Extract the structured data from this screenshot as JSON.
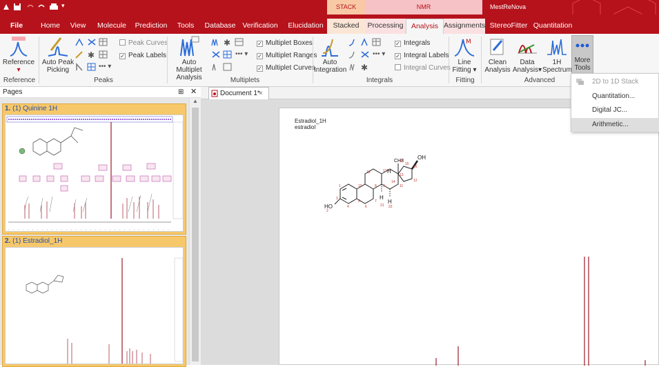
{
  "titlebar": {
    "group_stack": "STACK",
    "group_nmr": "NMR",
    "group_mestrenova": "MestReNova"
  },
  "tabs": [
    {
      "label": "File"
    },
    {
      "label": "Home"
    },
    {
      "label": "View"
    },
    {
      "label": "Molecule"
    },
    {
      "label": "Prediction"
    },
    {
      "label": "Tools"
    },
    {
      "label": "Database"
    },
    {
      "label": "Verification"
    },
    {
      "label": "Elucidation"
    },
    {
      "label": "Stacked"
    },
    {
      "label": "Processing"
    },
    {
      "label": "Analysis"
    },
    {
      "label": "Assignments"
    },
    {
      "label": "StereoFitter"
    },
    {
      "label": "Quantitation"
    }
  ],
  "ribbon": {
    "reference": {
      "label": "Reference",
      "group": "Reference"
    },
    "auto_peak": {
      "label_line1": "Auto Peak",
      "label_line2": "Picking"
    },
    "peaks_group": "Peaks",
    "peak_curves": "Peak Curves",
    "peak_labels": "Peak Labels",
    "auto_multiplet": {
      "label_line1": "Auto Multiplet",
      "label_line2": "Analysis"
    },
    "multiplets_group": "Multiplets",
    "multiplet_boxes": "Multiplet Boxes",
    "multiplet_ranges": "Multiplet Ranges",
    "multiplet_curves": "Multiplet Curves",
    "auto_integration": {
      "label_line1": "Auto",
      "label_line2": "Integration"
    },
    "integrals_group": "Integrals",
    "integrals": "Integrals",
    "integral_labels": "Integral Labels",
    "integral_curves": "Integral Curves",
    "line_fitting": {
      "label_line1": "Line",
      "label_line2": "Fitting ▾"
    },
    "fitting_group": "Fitting",
    "clean": {
      "label_line1": "Clean",
      "label_line2": "Analysis"
    },
    "data": {
      "label_line1": "Data",
      "label_line2": "Analysis▾"
    },
    "spectrum_1h": {
      "label_line1": "1H",
      "label_line2": "Spectrum▾"
    },
    "advanced_group": "Advanced",
    "more_tools": {
      "label_line1": "More",
      "label_line2": "Tools ▾"
    }
  },
  "pages_panel": {
    "title": "Pages",
    "items": [
      {
        "number": "1.",
        "label": "(1) Quinine 1H"
      },
      {
        "number": "2.",
        "label": "(1) Estradiol_1H"
      }
    ]
  },
  "document_tab": {
    "label": "Document 1*",
    "close": "×"
  },
  "document": {
    "title_line1": "Estradiol_1H",
    "title_line2": "estradiol",
    "oh_label": "OH",
    "ch3_label": "CH3",
    "ho_label": "HO",
    "h_labels": [
      "H",
      "H",
      "H"
    ],
    "atom_numbers": [
      "1",
      "2",
      "3",
      "4",
      "5",
      "6",
      "7",
      "8",
      "9",
      "10",
      "11",
      "12",
      "13",
      "14",
      "15",
      "16",
      "17",
      "18",
      "20",
      "21",
      "22"
    ]
  },
  "more_tools_menu": {
    "items": [
      {
        "label": "2D to 1D Stack",
        "enabled": false
      },
      {
        "label": "Quantitation...",
        "enabled": true
      },
      {
        "label": "Digital JC...",
        "enabled": true
      },
      {
        "label": "Arithmetic...",
        "enabled": true
      }
    ]
  },
  "colors": {
    "brand_red": "#b5121b",
    "page_highlight": "#f6c86a",
    "spectrum": "#9b1b2a"
  }
}
